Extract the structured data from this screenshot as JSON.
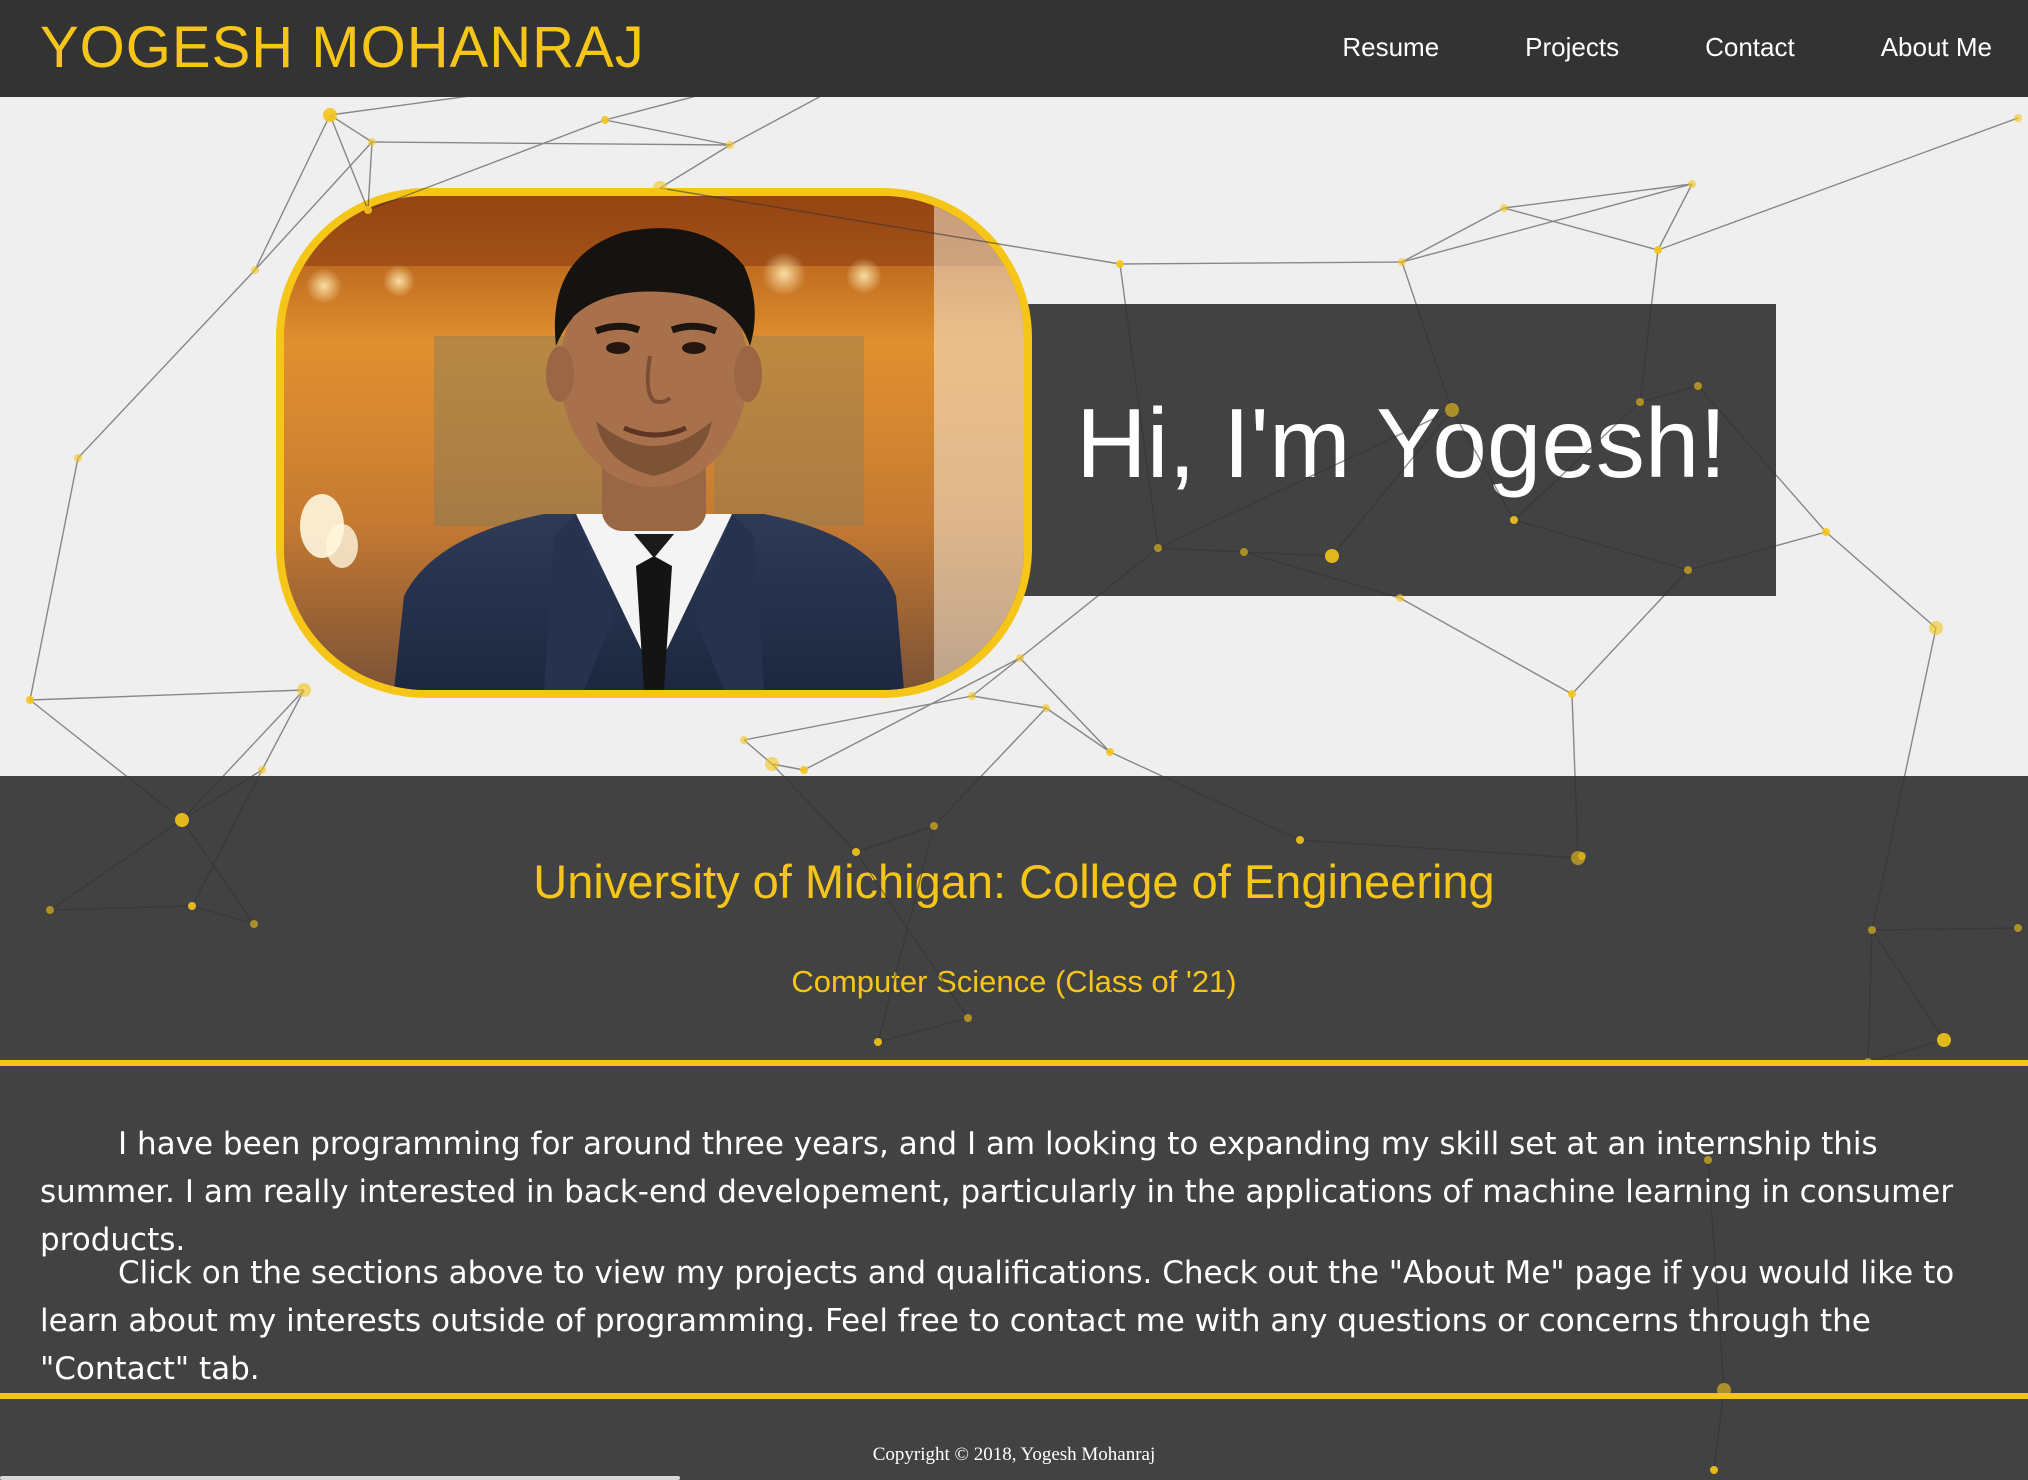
{
  "header": {
    "brand": "YOGESH MOHANRAJ",
    "nav": [
      {
        "label": "Resume",
        "name": "nav-link-resume"
      },
      {
        "label": "Projects",
        "name": "nav-link-projects"
      },
      {
        "label": "Contact",
        "name": "nav-link-contact"
      },
      {
        "label": "About Me",
        "name": "nav-link-about-me"
      }
    ]
  },
  "hero": {
    "greeting": "Hi, I'm Yogesh!"
  },
  "school": {
    "name": "University of Michigan: College of Engineering",
    "major": "Computer Science (Class of '21)"
  },
  "bio": {
    "paragraphs": [
      "I have been programming for around three years, and I am looking to expanding my skill set at an internship this summer. I am really interested in back-end developement, particularly in the applications of machine learning in consumer products.",
      "Click on the sections above to view my projects and qualifications. Check out the \"About Me\" page if you would like to learn about my interests outside of programming. Feel free to contact me with any questions or concerns through the \"Contact\" tab."
    ]
  },
  "footer": {
    "copyright": "Copyright © 2018, Yogesh Mohanraj"
  },
  "colors": {
    "accent": "#f5c518",
    "dark": "#424242",
    "navbar": "#333333",
    "light_background": "#efefef"
  }
}
